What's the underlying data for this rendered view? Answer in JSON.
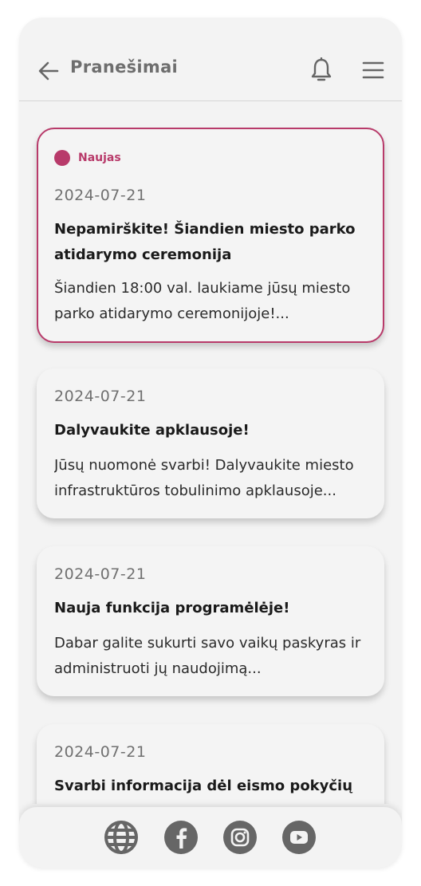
{
  "header": {
    "title": "Pranešimai",
    "back_icon": "arrow-left-icon",
    "bell_icon": "bell-icon",
    "menu_icon": "hamburger-menu-icon"
  },
  "colors": {
    "accent": "#b83a6a",
    "icon": "#666666",
    "background": "#f3f3f3"
  },
  "notifications": [
    {
      "badge": "Naujas",
      "date": "2024-07-21",
      "title": "Nepamirškite! Šiandien miesto parko atidarymo ceremonija",
      "body": "Šiandien 18:00 val. laukiame jūsų miesto parko atidarymo ceremonijoje!..."
    },
    {
      "date": "2024-07-21",
      "title": "Dalyvaukite apklausoje!",
      "body": "Jūsų nuomonė svarbi! Dalyvaukite miesto infrastruktūros tobulinimo apklausoje..."
    },
    {
      "date": "2024-07-21",
      "title": "Nauja funkcija programėlėje!",
      "body": "Dabar galite sukurti savo vaikų paskyras ir administruoti jų naudojimą..."
    },
    {
      "date": "2024-07-21",
      "title": "Svarbi informacija dėl eismo pokyčių",
      "body": ""
    }
  ],
  "footer": {
    "icons": [
      "globe-icon",
      "facebook-icon",
      "instagram-icon",
      "youtube-icon"
    ]
  }
}
